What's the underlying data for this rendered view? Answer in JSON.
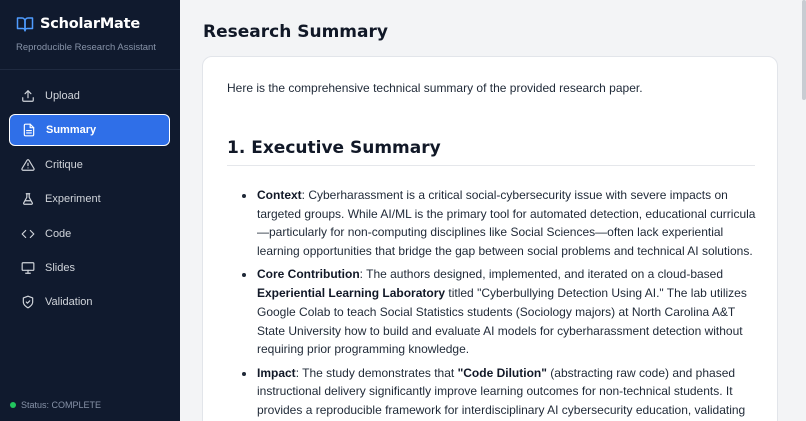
{
  "brand": {
    "name": "ScholarMate",
    "subtitle": "Reproducible Research Assistant"
  },
  "sidebar": {
    "items": [
      {
        "label": "Upload",
        "icon": "upload-icon"
      },
      {
        "label": "Summary",
        "icon": "document-icon",
        "active": true
      },
      {
        "label": "Critique",
        "icon": "warning-icon"
      },
      {
        "label": "Experiment",
        "icon": "flask-icon"
      },
      {
        "label": "Code",
        "icon": "code-icon"
      },
      {
        "label": "Slides",
        "icon": "presentation-icon"
      },
      {
        "label": "Validation",
        "icon": "shield-check-icon"
      }
    ],
    "status": "Status: COMPLETE"
  },
  "main": {
    "title": "Research Summary",
    "intro": "Here is the comprehensive technical summary of the provided research paper.",
    "section_heading": "1. Executive Summary",
    "bullets": [
      {
        "label": "Context",
        "text": ": Cyberharassment is a critical social-cybersecurity issue with severe impacts on targeted groups. While AI/ML is the primary tool for automated detection, educational curricula—particularly for non-computing disciplines like Social Sciences—often lack experiential learning opportunities that bridge the gap between social problems and technical AI solutions."
      },
      {
        "label": "Core Contribution",
        "text_1": ": The authors designed, implemented, and iterated on a cloud-based ",
        "strong": "Experiential Learning Laboratory",
        "text_2": " titled \"Cyberbullying Detection Using AI.\" The lab utilizes Google Colab to teach Social Statistics students (Sociology majors) at North Carolina A&T State University how to build and evaluate AI models for cyberharassment detection without requiring prior programming knowledge."
      },
      {
        "label": "Impact",
        "text_1": ": The study demonstrates that ",
        "strong": "\"Code Dilution\"",
        "text_2": " (abstracting raw code) and phased instructional delivery significantly improve learning outcomes for non-technical students. It provides a reproducible framework for interdisciplinary AI cybersecurity education, validating"
      }
    ]
  },
  "colors": {
    "sidebar_bg": "#101a2e",
    "accent": "#2f6fe8",
    "status": "#22c55e"
  }
}
